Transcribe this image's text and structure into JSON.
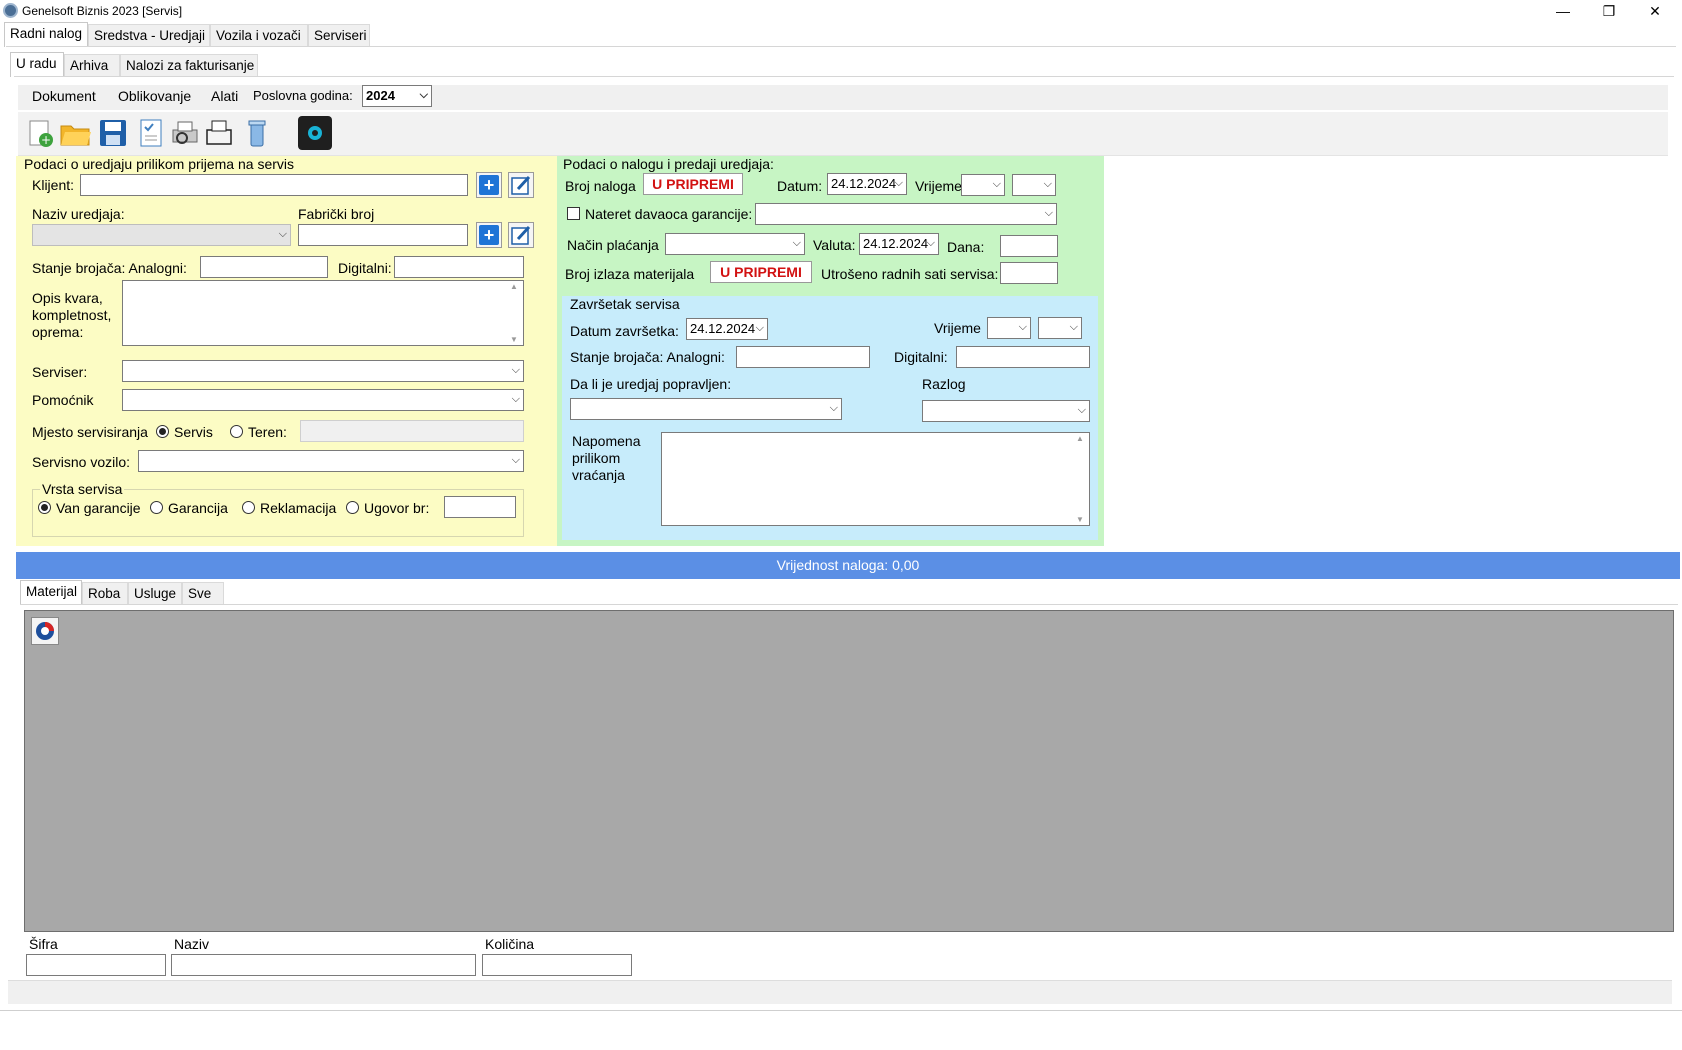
{
  "window": {
    "title": "Genelsoft Biznis 2023 [Servis]",
    "controls": {
      "minimize": "—",
      "restore": "❐",
      "close": "✕"
    }
  },
  "main_tabs": [
    "Radni nalog",
    "Sredstva - Uredjaji",
    "Vozila i vozači",
    "Serviseri"
  ],
  "sub_tabs": [
    "U radu",
    "Arhiva",
    "Nalozi za fakturisanje"
  ],
  "menu": {
    "items": [
      "Dokument",
      "Oblikovanje",
      "Alati"
    ],
    "year_label": "Poslovna godina:",
    "year_value": "2024"
  },
  "toolbar": {
    "icons": [
      "new-document-icon",
      "open-folder-icon",
      "save-icon",
      "checklist-icon",
      "print-preview-icon",
      "print-icon",
      "recycle-bin-icon",
      "settings-icon"
    ]
  },
  "device": {
    "section_title": "Podaci o uredjaju prilikom prijema na servis",
    "client_label": "Klijent:",
    "client_value": "",
    "device_name_label": "Naziv uredjaja:",
    "serial_label": "Fabrički broj",
    "counter_label": "Stanje brojača: Analogni:",
    "digital_label": "Digitalni:",
    "fault_label_1": "Opis kvara,",
    "fault_label_2": "kompletnost,",
    "fault_label_3": "oprema:",
    "serviser_label": "Serviser:",
    "assistant_label": "Pomoćnik",
    "location_label": "Mjesto servisiranja",
    "location_opt_service": "Servis",
    "location_opt_field": "Teren:",
    "vehicle_label": "Servisno vozilo:",
    "service_type_title": "Vrsta servisa",
    "service_types": [
      "Van garancije",
      "Garancija",
      "Reklamacija",
      "Ugovor br:"
    ]
  },
  "order": {
    "section_title": "Podaci o nalogu i predaji uredjaja:",
    "order_no_label": "Broj naloga",
    "order_no_value": "U PRIPREMI",
    "date_label": "Datum:",
    "date_value": "24.12.2024",
    "time_label": "Vrijeme",
    "warranty_label": "Nateret davaoca garancije:",
    "payment_label": "Način plaćanja",
    "currency_label": "Valuta:",
    "currency_date": "24.12.2024",
    "days_label": "Dana:",
    "material_out_label": "Broj izlaza materijala",
    "material_out_value": "U PRIPREMI",
    "hours_label": "Utrošeno radnih sati servisa:"
  },
  "completion": {
    "section_title": "Završetak servisa",
    "end_date_label": "Datum završetka:",
    "end_date_value": "24.12.2024",
    "time_label": "Vrijeme",
    "counter_label": "Stanje brojača: Analogni:",
    "digital_label": "Digitalni:",
    "repaired_label": "Da li je uredjaj popravljen:",
    "reason_label": "Razlog",
    "note_label_1": "Napomena",
    "note_label_2": "prilikom",
    "note_label_3": "vraćanja"
  },
  "total": "Vrijednost naloga: 0,00",
  "item_tabs": [
    "Materijal",
    "Roba",
    "Usluge",
    "Sve"
  ],
  "footer_fields": {
    "code": "Šifra",
    "name": "Naziv",
    "quantity": "Količina"
  }
}
